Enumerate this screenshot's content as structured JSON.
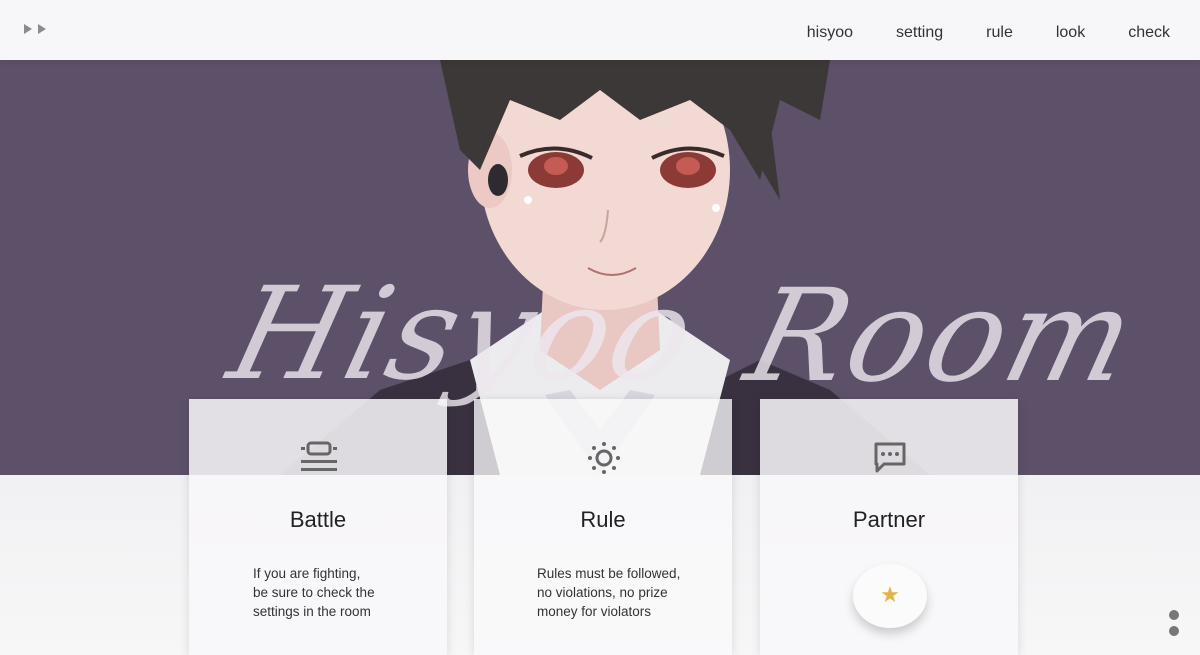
{
  "nav": {
    "items": [
      "hisyoo",
      "setting",
      "rule",
      "look",
      "check"
    ]
  },
  "hero": {
    "title_left": "Hisyoo",
    "title_right": "Room",
    "background_color": "#5d5169"
  },
  "cards": [
    {
      "title": "Battle",
      "icon": "list-icon",
      "desc_lines": [
        "If you are fighting,",
        "be sure to check the",
        "settings in the room"
      ]
    },
    {
      "title": "Rule",
      "icon": "sun-icon",
      "desc_lines": [
        "Rules must be followed,",
        "no violations, no prize",
        "money for violators"
      ]
    },
    {
      "title": "Partner",
      "icon": "chat-bubble-icon",
      "badge_icon": "star-icon",
      "badge_symbol": "★"
    }
  ],
  "colors": {
    "hero": "#5d5169",
    "topbar": "#f7f6f8",
    "accent_star": "#e3b34a"
  }
}
